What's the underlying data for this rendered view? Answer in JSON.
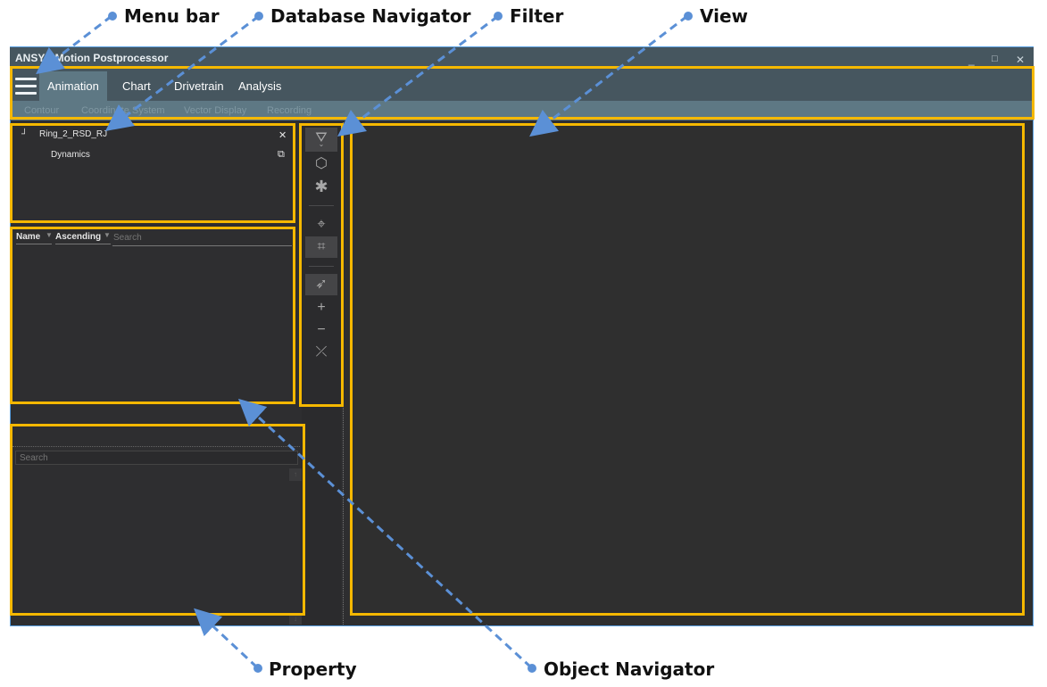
{
  "window": {
    "title": "ANSYS Motion Postprocessor",
    "controls": {
      "minimize": "_",
      "maximize": "□",
      "close": "✕"
    }
  },
  "menubar": {
    "menu_icon": "hamburger-icon",
    "tabs": [
      {
        "label": "Animation",
        "active": true
      },
      {
        "label": "Chart",
        "active": false
      },
      {
        "label": "Drivetrain",
        "active": false
      },
      {
        "label": "Analysis",
        "active": false
      }
    ],
    "subtools": [
      "Contour",
      "Coordinate System",
      "Vector Display",
      "Recording"
    ]
  },
  "database_navigator": {
    "items": [
      {
        "label": "Ring_2_RSD_RJ",
        "expand_glyph": "┘",
        "action_icon": "close-icon",
        "action_glyph": "✕"
      },
      {
        "label": "Dynamics",
        "action_icon": "copy-icon",
        "action_glyph": "⧉"
      }
    ]
  },
  "object_navigator": {
    "sort_field": "Name",
    "sort_order": "Ascending",
    "search_placeholder": "Search"
  },
  "property": {
    "search_placeholder": "Search",
    "scroll_up": "↑",
    "scroll_down": "↓"
  },
  "filter_toolbar": {
    "tools": [
      {
        "icon": "filter-icon",
        "glyph": "⛛",
        "active": true
      },
      {
        "icon": "cube-icon",
        "glyph": "⬡",
        "active": false
      },
      {
        "icon": "asterisk-icon",
        "glyph": "✱",
        "active": false
      },
      {
        "icon": "crosshair-icon",
        "glyph": "⌖",
        "active": false
      },
      {
        "icon": "nodes-icon",
        "glyph": "⌗",
        "active": true
      },
      {
        "icon": "pointer-icon",
        "glyph": "➶",
        "active": true
      },
      {
        "icon": "add-icon",
        "glyph": "+",
        "active": false
      },
      {
        "icon": "remove-icon",
        "glyph": "−",
        "active": false
      },
      {
        "icon": "clear-selection-icon",
        "glyph": "⤫",
        "active": false
      }
    ]
  },
  "annotations": {
    "menu_bar": "Menu bar",
    "database_navigator": "Database Navigator",
    "filter": "Filter",
    "view": "View",
    "property": "Property",
    "object_navigator": "Object Navigator"
  },
  "colors": {
    "highlight_border": "#f5b800",
    "annotation_arrow": "#5b90d6",
    "title_bar": "#46565f",
    "subtoolbar": "#5e7884",
    "panel_bg": "#2e2e30"
  }
}
